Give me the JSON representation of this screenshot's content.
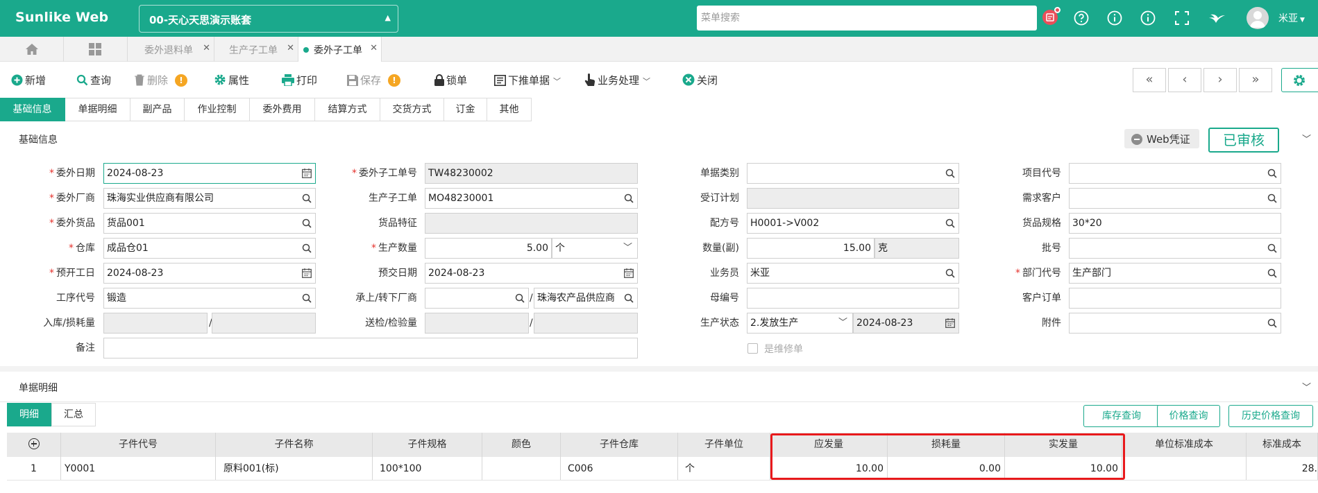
{
  "topbar": {
    "brand": "Sunlike Web",
    "account": "00-天心天思演示账套",
    "search_placeholder": "菜单搜索",
    "username": "米亚"
  },
  "tabs": {
    "items": [
      {
        "label": "委外退料单"
      },
      {
        "label": "生产子工单"
      },
      {
        "label": "委外子工单"
      }
    ]
  },
  "toolbar": {
    "new": "新增",
    "query": "查询",
    "delete": "删除",
    "properties": "属性",
    "print": "打印",
    "save": "保存",
    "lock": "锁单",
    "push": "下推单据",
    "business": "业务处理",
    "close": "关闭"
  },
  "section_tabs": [
    "基础信息",
    "单据明细",
    "副产品",
    "作业控制",
    "委外费用",
    "结算方式",
    "交货方式",
    "订金",
    "其他"
  ],
  "basic": {
    "title": "基础信息",
    "web_voucher": "Web凭证",
    "status": "已审核"
  },
  "form": {
    "c1": [
      {
        "label": "委外日期",
        "value": "2024-08-23"
      },
      {
        "label": "委外厂商",
        "value": "珠海实业供应商有限公司"
      },
      {
        "label": "委外货品",
        "value": "货品001"
      },
      {
        "label": "仓库",
        "value": "成品仓01"
      },
      {
        "label": "预开工日",
        "value": "2024-08-23"
      },
      {
        "label": "工序代号",
        "value": "锻造"
      },
      {
        "label": "入库/损耗量",
        "value": ""
      },
      {
        "label": "备注",
        "value": ""
      }
    ],
    "c2": [
      {
        "label": "委外子工单号",
        "value": "TW48230002"
      },
      {
        "label": "生产子工单",
        "value": "MO48230001"
      },
      {
        "label": "货品特征",
        "value": ""
      },
      {
        "label": "生产数量",
        "value": "5.00",
        "unit": "个"
      },
      {
        "label": "预交日期",
        "value": "2024-08-23"
      },
      {
        "label": "承上/转下厂商",
        "value": "",
        "value2": "珠海农产品供应商"
      },
      {
        "label": "送检/检验量",
        "value": ""
      }
    ],
    "c3": [
      {
        "label": "单据类别",
        "value": ""
      },
      {
        "label": "受订计划",
        "value": ""
      },
      {
        "label": "配方号",
        "value": "H0001->V002"
      },
      {
        "label": "数量(副)",
        "value": "15.00",
        "unit": "克"
      },
      {
        "label": "业务员",
        "value": "米亚"
      },
      {
        "label": "母编号",
        "value": ""
      },
      {
        "label": "生产状态",
        "value": "2.发放生产",
        "date": "2024-08-23"
      },
      {
        "label": "是维修单"
      }
    ],
    "c4": [
      {
        "label": "项目代号",
        "value": ""
      },
      {
        "label": "需求客户",
        "value": ""
      },
      {
        "label": "货品规格",
        "value": "30*20"
      },
      {
        "label": "批号",
        "value": ""
      },
      {
        "label": "部门代号",
        "value": "生产部门"
      },
      {
        "label": "客户订单",
        "value": ""
      },
      {
        "label": "附件",
        "value": ""
      }
    ]
  },
  "detail": {
    "title": "单据明细",
    "sub_tabs": [
      "明细",
      "汇总"
    ],
    "buttons": [
      "库存查询",
      "价格查询",
      "历史价格查询"
    ],
    "columns": [
      "子件代号",
      "子件名称",
      "子件规格",
      "颜色",
      "子件仓库",
      "子件单位",
      "应发量",
      "损耗量",
      "实发量",
      "单位标准成本",
      "标准成本"
    ],
    "rows": [
      {
        "no": "1",
        "code": "Y0001",
        "name": "原料001(标)",
        "spec": "100*100",
        "color": "",
        "wh": "C006",
        "unit": "个",
        "due": "10.00",
        "loss": "0.00",
        "actual": "10.00",
        "unit_cost": "",
        "cost": "28."
      }
    ]
  }
}
